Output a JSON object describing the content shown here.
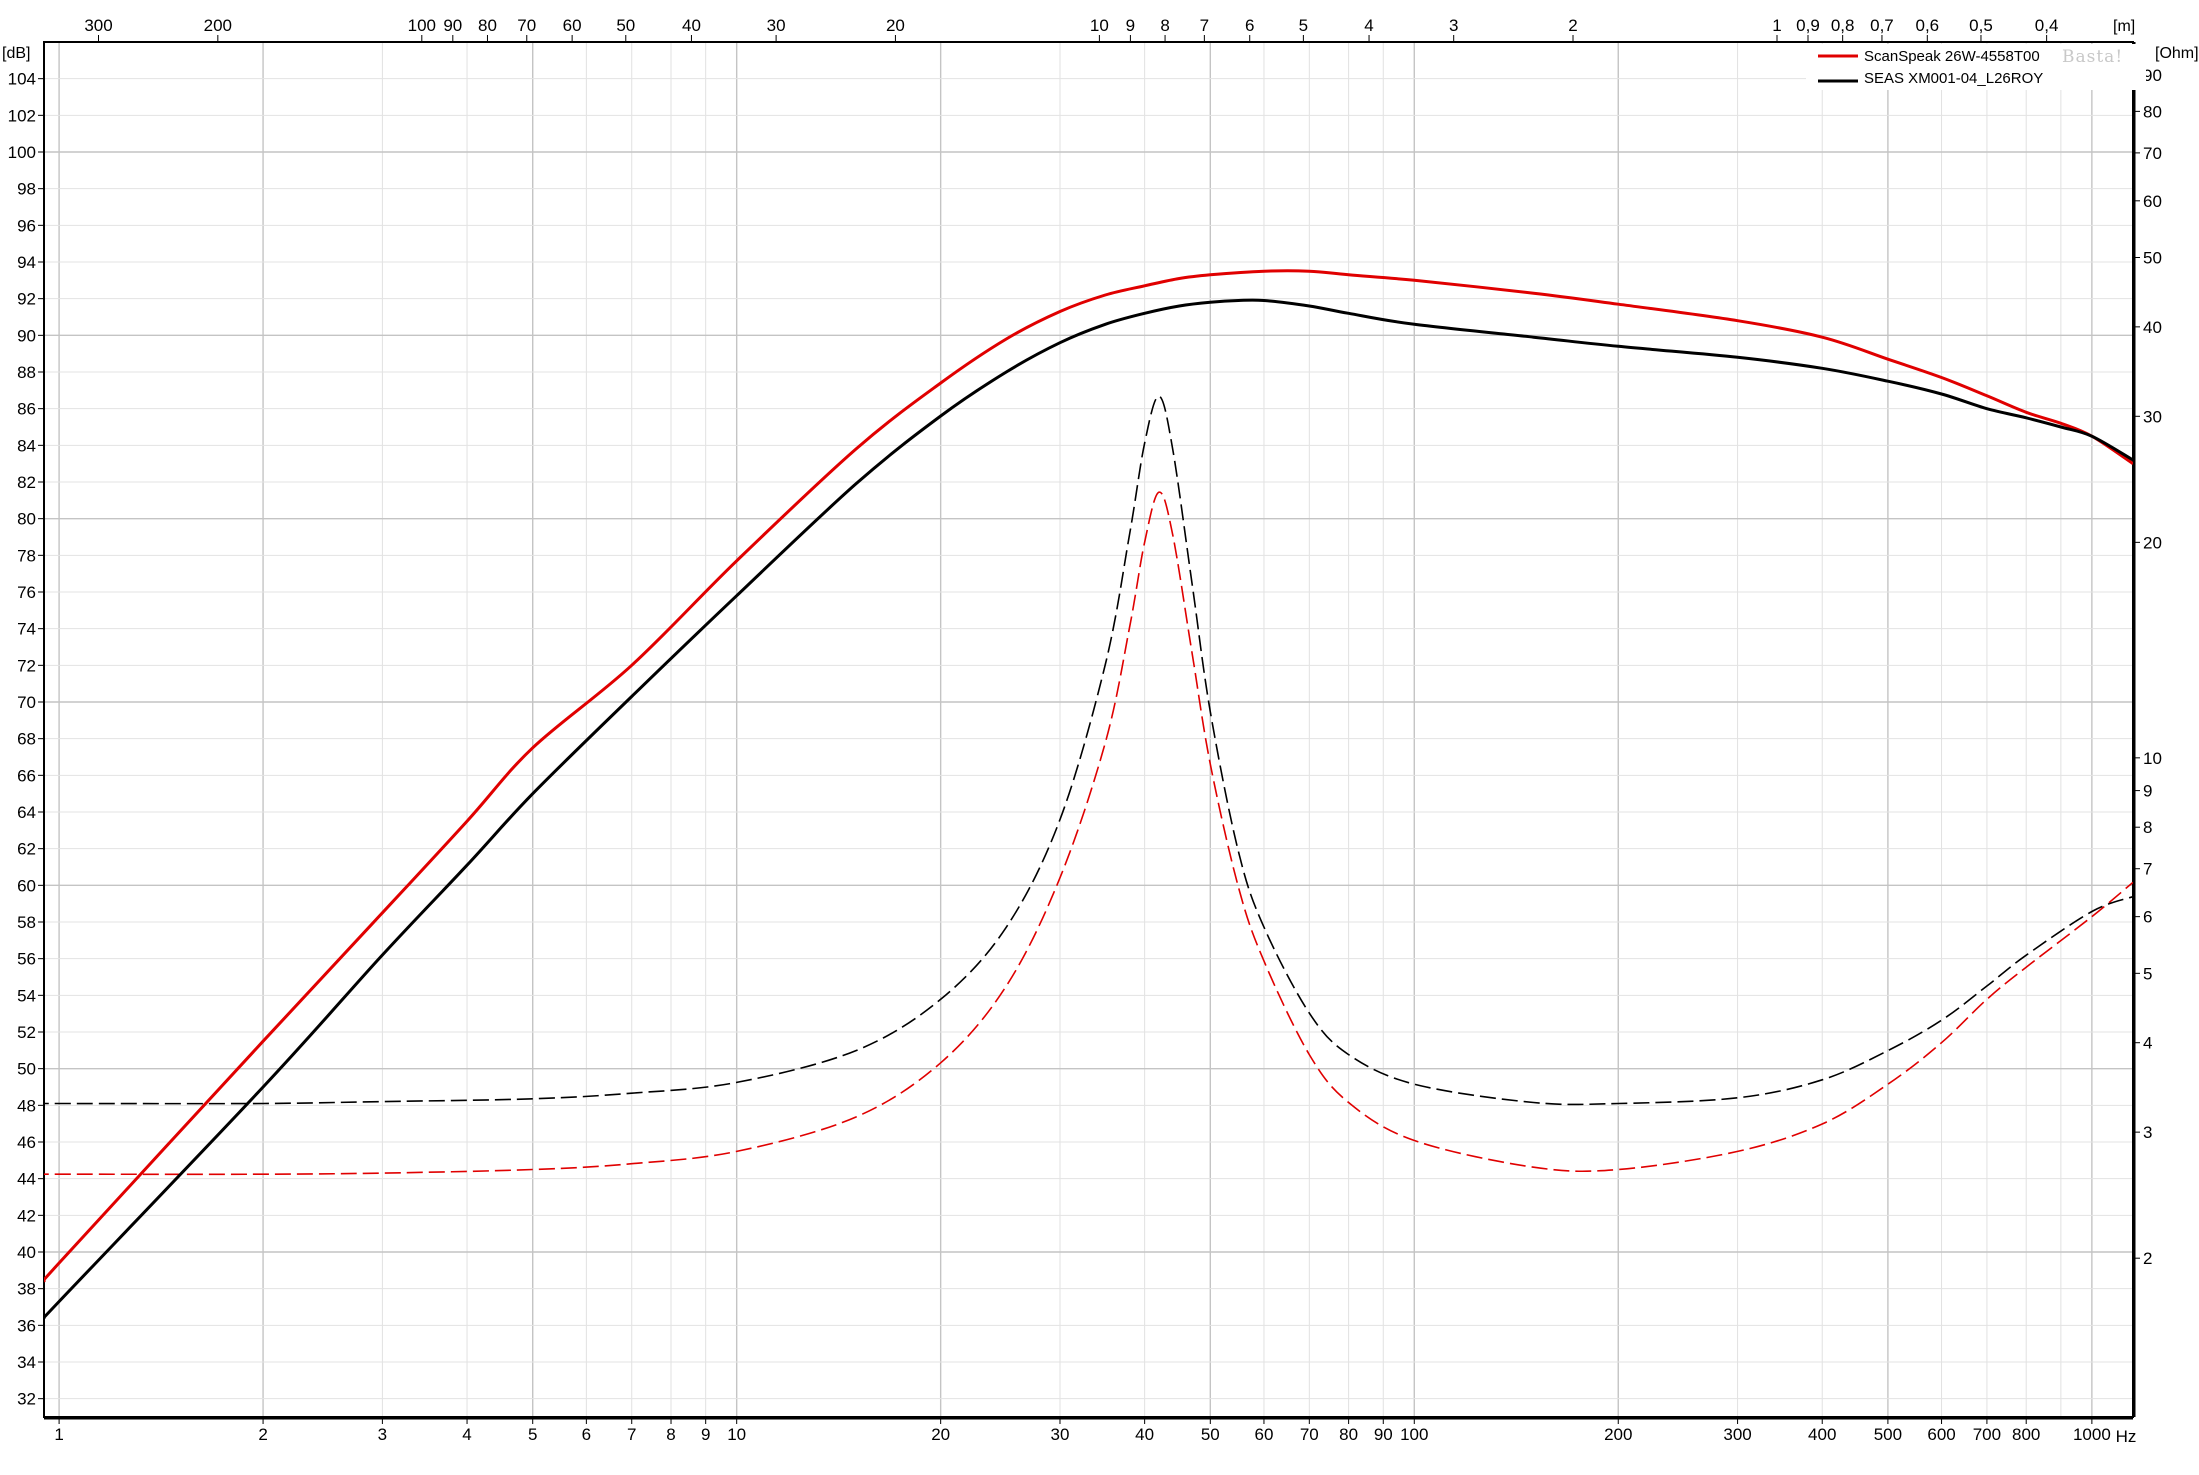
{
  "chart_data": {
    "type": "line",
    "title": "",
    "watermark": "Basta!",
    "x_axis": {
      "label": "Hz",
      "scale": "log",
      "range": [
        0.95,
        1150
      ],
      "tick_values": [
        1,
        2,
        3,
        4,
        5,
        6,
        7,
        8,
        9,
        10,
        20,
        30,
        40,
        50,
        60,
        70,
        80,
        90,
        100,
        200,
        300,
        400,
        500,
        600,
        700,
        800,
        1000
      ],
      "tick_labels": [
        "1",
        "2",
        "3",
        "4",
        "5",
        "6",
        "7",
        "8",
        "9",
        "10",
        "20",
        "30",
        "40",
        "50",
        "60",
        "70",
        "80",
        "90",
        "100",
        "200",
        "300",
        "400",
        "500",
        "600",
        "700",
        "800",
        "1000"
      ]
    },
    "top_axis": {
      "label": "[m]",
      "tick_labels": [
        "300",
        "200",
        "100",
        "90",
        "80",
        "70",
        "60",
        "50",
        "40",
        "30",
        "20",
        "10",
        "9",
        "8",
        "7",
        "6",
        "5",
        "4",
        "3",
        "2",
        "1",
        "0,9",
        "0,8",
        "0,7",
        "0,6",
        "0,5",
        "0,4"
      ],
      "tick_wavelengths": [
        300,
        200,
        100,
        90,
        80,
        70,
        60,
        50,
        40,
        30,
        20,
        10,
        9,
        8,
        7,
        6,
        5,
        4,
        3,
        2,
        1,
        0.9,
        0.8,
        0.7,
        0.6,
        0.5,
        0.4
      ]
    },
    "y_left": {
      "label": "[dB]",
      "range": [
        31,
        106
      ],
      "tick_labels": [
        "32",
        "34",
        "36",
        "38",
        "40",
        "42",
        "44",
        "46",
        "48",
        "50",
        "52",
        "54",
        "56",
        "58",
        "60",
        "62",
        "64",
        "66",
        "68",
        "70",
        "72",
        "74",
        "76",
        "78",
        "80",
        "82",
        "84",
        "86",
        "88",
        "90",
        "92",
        "94",
        "96",
        "98",
        "100",
        "102",
        "104"
      ]
    },
    "y_right": {
      "label": "[Ohm]",
      "scale": "log",
      "range": [
        1.2,
        100
      ],
      "tick_labels": [
        "2",
        "3",
        "4",
        "5",
        "6",
        "7",
        "8",
        "9",
        "10",
        "20",
        "30",
        "40",
        "50",
        "60",
        "70",
        "80",
        "90"
      ]
    },
    "grid": true,
    "legend": {
      "position": "top-right"
    },
    "series": [
      {
        "name": "ScanSpeak 26W-4558T00",
        "quantity": "SPL",
        "axis": "left",
        "color": "#e00000",
        "style": "solid",
        "x": [
          0.95,
          1,
          2,
          3,
          4,
          5,
          7,
          10,
          15,
          20,
          25,
          30,
          35,
          40,
          45,
          50,
          60,
          70,
          80,
          100,
          150,
          200,
          300,
          400,
          500,
          600,
          700,
          800,
          900,
          1000,
          1150
        ],
        "y": [
          38.4,
          39.4,
          51.5,
          58.5,
          63.5,
          67.5,
          72.0,
          77.7,
          83.8,
          87.4,
          89.8,
          91.3,
          92.2,
          92.7,
          93.1,
          93.3,
          93.5,
          93.5,
          93.3,
          93.0,
          92.3,
          91.7,
          90.8,
          89.9,
          88.7,
          87.7,
          86.7,
          85.8,
          85.2,
          84.5,
          83.0
        ]
      },
      {
        "name": "SEAS XM001-04_L26ROY",
        "quantity": "SPL",
        "axis": "left",
        "color": "#000000",
        "style": "solid",
        "x": [
          0.95,
          1,
          2,
          3,
          4,
          5,
          7,
          10,
          15,
          20,
          25,
          30,
          35,
          40,
          45,
          50,
          55,
          60,
          70,
          80,
          100,
          150,
          200,
          300,
          400,
          500,
          600,
          700,
          800,
          900,
          1000,
          1150
        ],
        "y": [
          36.4,
          37.3,
          49.0,
          56.2,
          61.1,
          65.0,
          70.3,
          75.8,
          81.9,
          85.6,
          88.0,
          89.6,
          90.6,
          91.2,
          91.6,
          91.8,
          91.9,
          91.9,
          91.6,
          91.2,
          90.6,
          89.9,
          89.4,
          88.8,
          88.2,
          87.5,
          86.8,
          86.0,
          85.5,
          85.0,
          84.5,
          83.2
        ]
      },
      {
        "name": "ScanSpeak 26W-4558T00",
        "quantity": "Impedance",
        "axis": "right",
        "color": "#e00000",
        "style": "dashed",
        "x": [
          0.95,
          1,
          2,
          3,
          5,
          7,
          10,
          15,
          20,
          25,
          30,
          35,
          38,
          40,
          42,
          44,
          47,
          50,
          55,
          60,
          70,
          80,
          100,
          150,
          200,
          300,
          400,
          500,
          600,
          700,
          800,
          1000,
          1150
        ],
        "y": [
          2.62,
          2.62,
          2.62,
          2.63,
          2.66,
          2.71,
          2.82,
          3.15,
          3.75,
          4.8,
          6.8,
          10.5,
          15.2,
          20.0,
          23.5,
          20.5,
          14.0,
          9.8,
          6.6,
          5.2,
          3.85,
          3.3,
          2.92,
          2.68,
          2.66,
          2.82,
          3.08,
          3.5,
          4.0,
          4.6,
          5.1,
          6.0,
          6.7
        ]
      },
      {
        "name": "SEAS XM001-04_L26ROY",
        "quantity": "Impedance",
        "axis": "right",
        "color": "#000000",
        "style": "dashed",
        "x": [
          0.95,
          1,
          2,
          3,
          5,
          7,
          10,
          15,
          20,
          25,
          30,
          35,
          38,
          40,
          42,
          44,
          47,
          50,
          55,
          60,
          70,
          80,
          100,
          150,
          200,
          300,
          400,
          500,
          600,
          700,
          800,
          1000,
          1150
        ],
        "y": [
          3.29,
          3.29,
          3.29,
          3.31,
          3.34,
          3.4,
          3.52,
          3.9,
          4.6,
          5.8,
          8.2,
          13.5,
          20.5,
          27.5,
          32.0,
          27.0,
          17.5,
          11.6,
          7.4,
          5.8,
          4.4,
          3.85,
          3.5,
          3.3,
          3.29,
          3.35,
          3.55,
          3.9,
          4.3,
          4.8,
          5.3,
          6.1,
          6.4
        ]
      }
    ]
  }
}
